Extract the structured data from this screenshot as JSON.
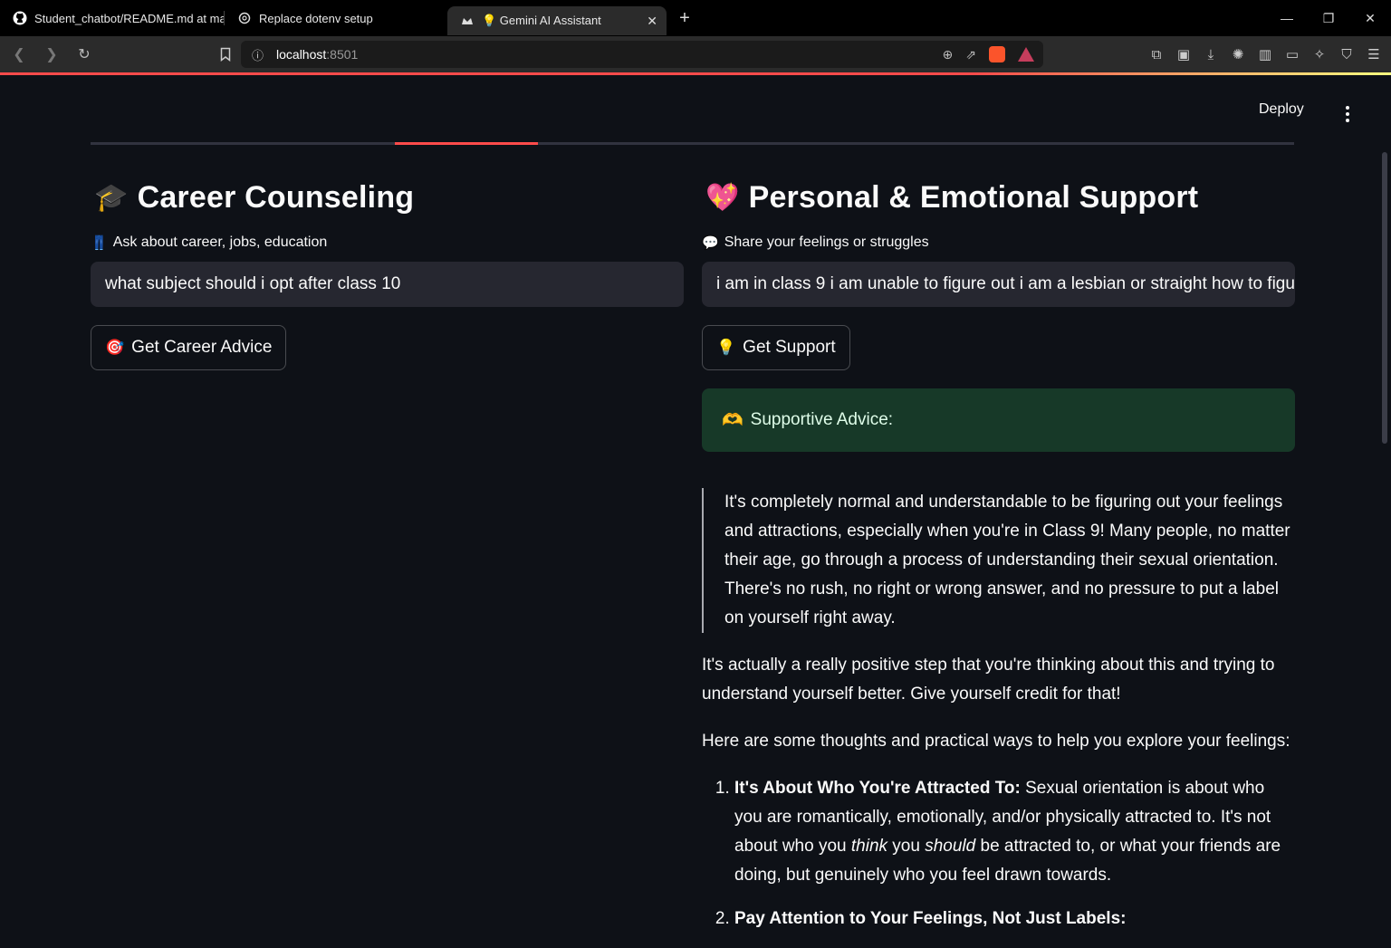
{
  "browser": {
    "tabs": [
      {
        "title": "Student_chatbot/README.md at mai",
        "icon": "github-icon"
      },
      {
        "title": "Replace dotenv setup",
        "icon": "openai-icon"
      },
      {
        "title": "💡 Gemini AI Assistant",
        "icon": "streamlit-icon",
        "active": true
      }
    ],
    "url_host": "localhost",
    "url_port": ":8501"
  },
  "app": {
    "deploy_label": "Deploy",
    "career": {
      "emoji": "🎓",
      "title": "Career Counseling",
      "label_emoji": "👖",
      "label": "Ask about career, jobs, education",
      "input_value": "what subject should i opt after class 10",
      "button_emoji": "🎯",
      "button_label": "Get Career Advice"
    },
    "support": {
      "emoji": "💖",
      "title": "Personal & Emotional Support",
      "label_emoji": "💬",
      "label": "Share your feelings or struggles",
      "input_value": "i am in class 9 i am unable to figure out i am a lesbian or straight how to figu",
      "button_emoji": "💡",
      "button_label": "Get Support",
      "result_emoji": "🫶",
      "result_label": "Supportive Advice:",
      "quote": "It's completely normal and understandable to be figuring out your feelings and attractions, especially when you're in Class 9! Many people, no matter their age, go through a process of understanding their sexual orientation. There's no rush, no right or wrong answer, and no pressure to put a label on yourself right away.",
      "para1": "It's actually a really positive step that you're thinking about this and trying to understand yourself better. Give yourself credit for that!",
      "para2": "Here are some thoughts and practical ways to help you explore your feelings:",
      "item1_bold": "It's About Who You're Attracted To:",
      "item1_a": " Sexual orientation is about who you are romantically, emotionally, and/or physically attracted to. It's not about who you ",
      "item1_em1": "think",
      "item1_b": " you ",
      "item1_em2": "should",
      "item1_c": " be attracted to, or what your friends are doing, but genuinely who you feel drawn towards.",
      "item2_bold": "Pay Attention to Your Feelings, Not Just Labels:"
    }
  }
}
